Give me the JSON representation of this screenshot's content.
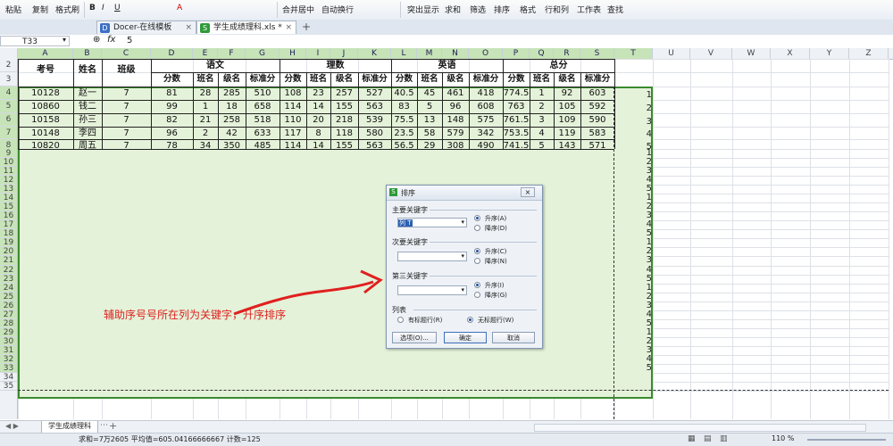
{
  "ribbon": {
    "items": [
      "粘贴",
      "复制",
      "格式刷",
      "合并居中",
      "自动换行",
      "求和",
      "筛选",
      "排序",
      "格式",
      "行和列",
      "工作表",
      "查找"
    ],
    "conditional": "突出显示",
    "format_buttons": [
      "B",
      "I",
      "U",
      "A"
    ]
  },
  "tabs": [
    {
      "label": "Docer-在线模板",
      "icon": "D"
    },
    {
      "label": "学生成绩理科.xls *",
      "icon": "S"
    }
  ],
  "formula_bar": {
    "cell_ref": "T33",
    "fx": "fx",
    "value": "5"
  },
  "columns": [
    "A",
    "B",
    "C",
    "D",
    "E",
    "F",
    "G",
    "H",
    "I",
    "J",
    "K",
    "L",
    "M",
    "N",
    "O",
    "P",
    "Q",
    "R",
    "S",
    "T",
    "U",
    "V",
    "W",
    "X",
    "Y",
    "Z"
  ],
  "rows": [
    "2",
    "3",
    "4",
    "5",
    "6",
    "7",
    "8",
    "9",
    "10",
    "11",
    "12",
    "13",
    "14",
    "15",
    "16",
    "17",
    "18",
    "19",
    "20",
    "21",
    "22",
    "23",
    "24",
    "25",
    "26",
    "27",
    "28",
    "29",
    "30",
    "31",
    "32",
    "33",
    "34",
    "35"
  ],
  "table": {
    "headers_fixed": [
      "考号",
      "姓名",
      "班级"
    ],
    "groups": [
      "语文",
      "理数",
      "英语",
      "总分"
    ],
    "subheaders": [
      "分数",
      "班名",
      "级名",
      "标准分"
    ],
    "rows": [
      [
        "10128",
        "赵一",
        "7",
        "81",
        "28",
        "285",
        "510",
        "108",
        "23",
        "257",
        "527",
        "40.5",
        "45",
        "461",
        "418",
        "774.5",
        "1",
        "92",
        "603"
      ],
      [
        "10860",
        "钱二",
        "7",
        "99",
        "1",
        "18",
        "658",
        "114",
        "14",
        "155",
        "563",
        "83",
        "5",
        "96",
        "608",
        "763",
        "2",
        "105",
        "592"
      ],
      [
        "10158",
        "孙三",
        "7",
        "82",
        "21",
        "258",
        "518",
        "110",
        "20",
        "218",
        "539",
        "75.5",
        "13",
        "148",
        "575",
        "761.5",
        "3",
        "109",
        "590"
      ],
      [
        "10148",
        "李四",
        "7",
        "96",
        "2",
        "42",
        "633",
        "117",
        "8",
        "118",
        "580",
        "23.5",
        "58",
        "579",
        "342",
        "753.5",
        "4",
        "119",
        "583"
      ],
      [
        "10820",
        "周五",
        "7",
        "78",
        "34",
        "350",
        "485",
        "114",
        "14",
        "155",
        "563",
        "56.5",
        "29",
        "308",
        "490",
        "741.5",
        "5",
        "143",
        "571"
      ]
    ]
  },
  "aux_col": [
    "1",
    "2",
    "3",
    "4",
    "5",
    "1",
    "2",
    "3",
    "4",
    "5",
    "1",
    "2",
    "3",
    "4",
    "5",
    "1",
    "2",
    "3",
    "4",
    "5",
    "1",
    "2",
    "3",
    "4",
    "5",
    "1",
    "2",
    "3",
    "4",
    "5"
  ],
  "annotation": "辅助序号号所在列为关键字，升序排序",
  "dialog": {
    "title": "排序",
    "primary_label": "主要关键字",
    "primary_value": "列 T",
    "secondary_label": "次要关键字",
    "tertiary_label": "第三关键字",
    "asc_a": "升序(A)",
    "desc_d": "降序(D)",
    "asc_c": "升序(C)",
    "desc_n": "降序(N)",
    "asc_i": "升序(I)",
    "desc_g": "降序(G)",
    "list_label": "列表",
    "has_header": "有标题行(R)",
    "no_header": "无标题行(W)",
    "options_btn": "选项(O)...",
    "ok_btn": "确定",
    "cancel_btn": "取消"
  },
  "sheet_tab": "学生成绩理科",
  "status": {
    "text": "求和=7万2605  平均值=605.04166666667  计数=125",
    "zoom": "110 %"
  },
  "colors": {
    "selection": "#e4f2d9",
    "selection_border": "#3b8a2f",
    "arrow": "#e02020",
    "annotation": "#e02020"
  }
}
